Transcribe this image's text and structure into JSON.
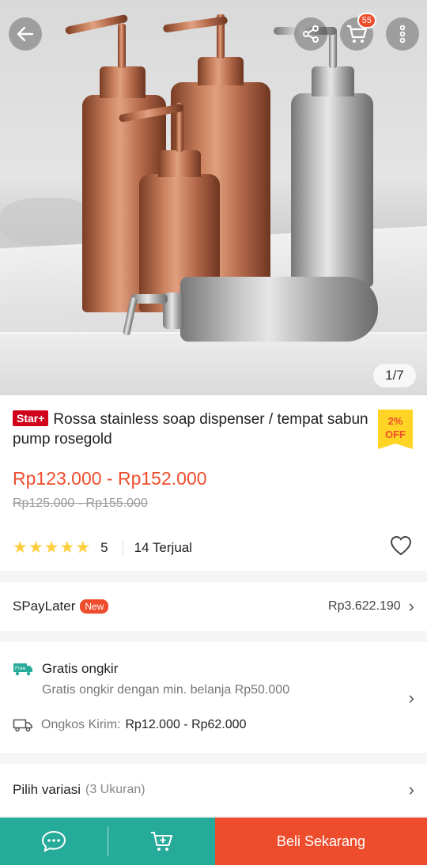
{
  "hero": {
    "image_counter": "1/7",
    "cart_count": "55"
  },
  "product": {
    "badge": "Star+",
    "title": "Rossa stainless soap dispenser / tempat sabun pump rosegold",
    "discount_pct": "2%",
    "discount_label": "OFF",
    "price_range": "Rp123.000 - Rp152.000",
    "original_price_range": "Rp125.000 - Rp155.000",
    "rating": 5,
    "rating_text": "5",
    "sold_text": "14 Terjual"
  },
  "spaylater": {
    "label": "SPayLater",
    "badge": "New",
    "amount": "Rp3.622.190"
  },
  "shipping": {
    "free_icon_text": "Free",
    "title": "Gratis ongkir",
    "subtitle": "Gratis ongkir dengan min. belanja Rp50.000",
    "cost_label": "Ongkos Kirim:",
    "cost_value": "Rp12.000 - Rp62.000"
  },
  "variation": {
    "label": "Pilih variasi",
    "count": "(3 Ukuran)"
  },
  "bottom_bar": {
    "buy_label": "Beli Sekarang"
  },
  "colors": {
    "brand": "#ee4d2d",
    "green": "#26aa99",
    "star": "#ffce3d",
    "discount_bg": "#ffd424"
  }
}
